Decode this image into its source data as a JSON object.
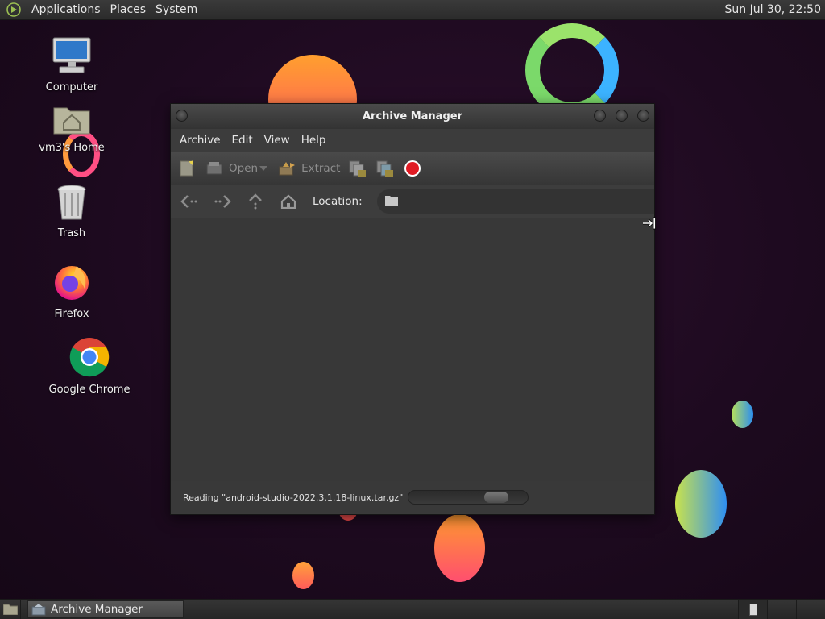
{
  "top_panel": {
    "menus": [
      "Applications",
      "Places",
      "System"
    ],
    "clock": "Sun Jul 30, 22:50"
  },
  "desktop_icons": [
    {
      "label": "Computer",
      "icon": "computer-icon"
    },
    {
      "label": "vm3's Home",
      "icon": "home-folder-icon"
    },
    {
      "label": "Trash",
      "icon": "trash-icon"
    },
    {
      "label": "Firefox",
      "icon": "firefox-icon"
    },
    {
      "label": "Google Chrome",
      "icon": "chrome-icon"
    }
  ],
  "window": {
    "title": "Archive Manager",
    "menubar": [
      "Archive",
      "Edit",
      "View",
      "Help"
    ],
    "toolbar": {
      "open_label": "Open",
      "extract_label": "Extract"
    },
    "location_label": "Location:",
    "status_text": "Reading \"android-studio-2022.3.1.18-linux.tar.gz\""
  },
  "taskbar": {
    "task_label": "Archive Manager"
  },
  "colors": {
    "desktop_bg": "#1d0a1f",
    "panel": "#2f2f2f",
    "window_bg": "#3a3a3a",
    "stop_red": "#e01b24"
  }
}
